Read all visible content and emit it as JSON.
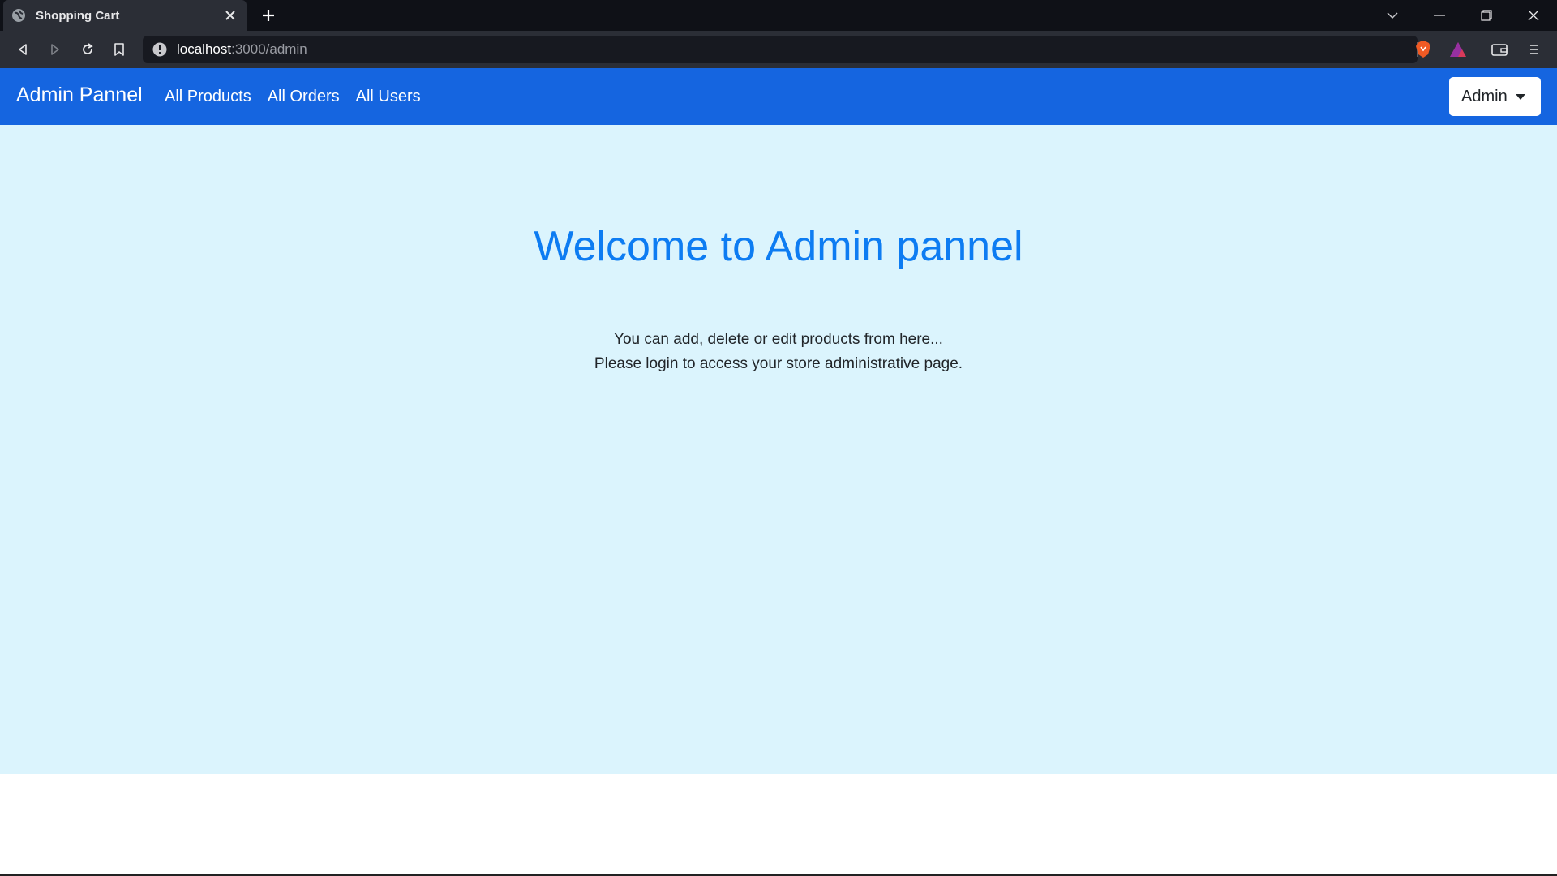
{
  "browser": {
    "tab_title": "Shopping Cart",
    "url_host": "localhost",
    "url_path": ":3000/admin"
  },
  "navbar": {
    "brand": "Admin Pannel",
    "links": [
      "All Products",
      "All Orders",
      "All Users"
    ],
    "user_menu_label": "Admin"
  },
  "hero": {
    "title": "Welcome to Admin pannel",
    "line1": "You can add, delete or edit products from here...",
    "line2": "Please login to access your store administrative page."
  },
  "colors": {
    "navbar": "#1565e0",
    "hero_background": "#dbf4fd",
    "title": "#0d7cf2"
  }
}
